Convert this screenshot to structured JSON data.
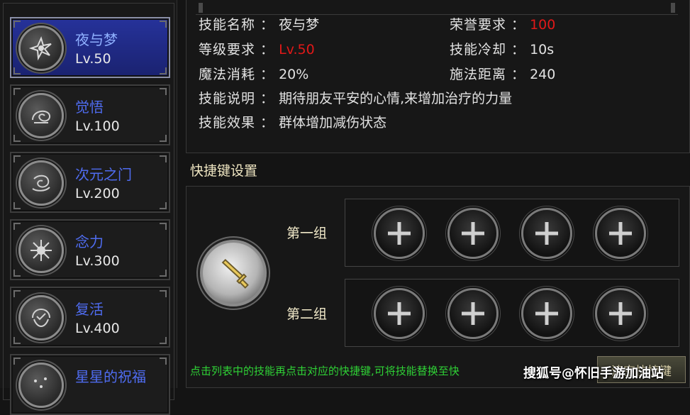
{
  "skills": [
    {
      "name": "夜与梦",
      "level": "Lv.50",
      "icon": "burst-icon"
    },
    {
      "name": "觉悟",
      "level": "Lv.100",
      "icon": "swirl-icon"
    },
    {
      "name": "次元之门",
      "level": "Lv.200",
      "icon": "vortex-icon"
    },
    {
      "name": "念力",
      "level": "Lv.300",
      "icon": "star-burst-icon"
    },
    {
      "name": "复活",
      "level": "Lv.400",
      "icon": "wreath-icon"
    },
    {
      "name": "星星的祝福",
      "level": "",
      "icon": "stars-icon"
    }
  ],
  "selected_skill_index": 0,
  "info": {
    "name_label": "技能名称 ：",
    "name_value": "夜与梦",
    "honor_label": "荣誉要求 ：",
    "honor_value": "100",
    "level_label": "等级要求 ：",
    "level_value": "Lv.50",
    "cooldown_label": "技能冷却 ：",
    "cooldown_value": "10s",
    "mana_label": "魔法消耗 ：",
    "mana_value": "20%",
    "range_label": "施法距离 ：",
    "range_value": "240",
    "desc_label": "技能说明 ：",
    "desc_value": "期待朋友平安的心情,来增加治疗的力量",
    "effect_label": "技能效果 ：",
    "effect_value": "群体增加减伤状态"
  },
  "shortcut": {
    "title": "快捷键设置",
    "group1_label": "第一组",
    "group2_label": "第二组",
    "hint": "点击列表中的技能再点击对应的快捷键,可将技能替换至快",
    "button_label": "清空快捷键"
  },
  "watermark": "搜狐号@怀旧手游加油站",
  "colors": {
    "selected_bg": "#26329a",
    "skill_name": "#4f6cf0",
    "red_value": "#e01818",
    "hint_green": "#2fd236"
  }
}
